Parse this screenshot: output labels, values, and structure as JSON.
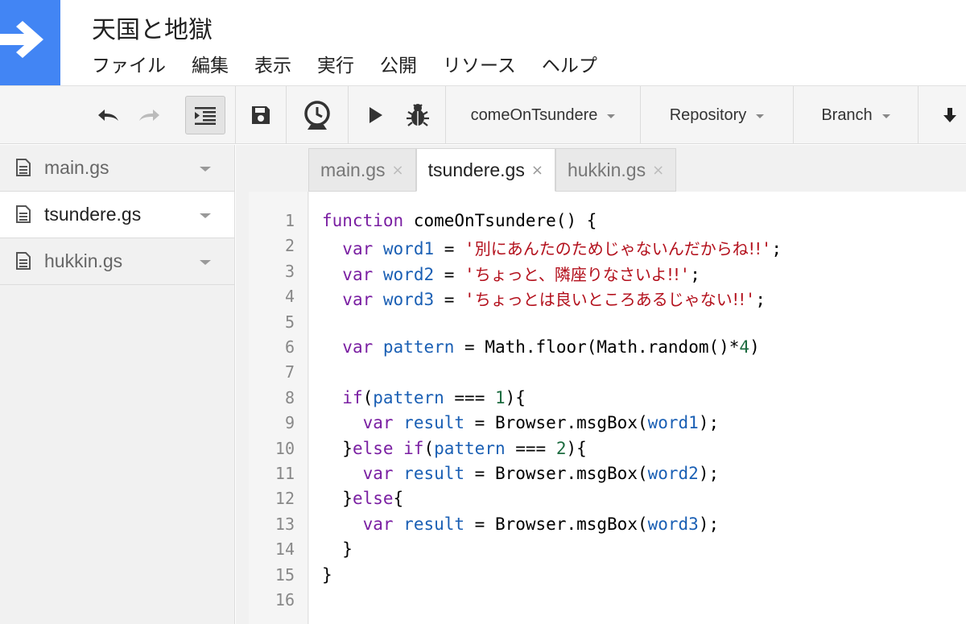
{
  "app": {
    "title": "天国と地獄",
    "menu": [
      "ファイル",
      "編集",
      "表示",
      "実行",
      "公開",
      "リソース",
      "ヘルプ"
    ]
  },
  "toolbar": {
    "function_select": "comeOnTsundere",
    "repository": "Repository",
    "branch": "Branch"
  },
  "sidebar": {
    "files": [
      {
        "name": "main.gs",
        "active": false
      },
      {
        "name": "tsundere.gs",
        "active": true
      },
      {
        "name": "hukkin.gs",
        "active": false
      }
    ]
  },
  "tabs": [
    {
      "name": "main.gs",
      "close": "×",
      "active": false
    },
    {
      "name": "tsundere.gs",
      "close": "×",
      "active": true
    },
    {
      "name": "hukkin.gs",
      "close": "×",
      "active": false
    }
  ],
  "code": {
    "line_numbers": [
      "1",
      "2",
      "3",
      "4",
      "5",
      "6",
      "7",
      "8",
      "9",
      "10",
      "11",
      "12",
      "13",
      "14",
      "15",
      "16"
    ],
    "lines": [
      [
        [
          "k",
          "function"
        ],
        [
          "p",
          " comeOnTsundere() {"
        ]
      ],
      [
        [
          "p",
          "  "
        ],
        [
          "k",
          "var"
        ],
        [
          "p",
          " "
        ],
        [
          "v",
          "word1"
        ],
        [
          "p",
          " = "
        ],
        [
          "s",
          "'"
        ],
        [
          "j",
          "別にあんたのためじゃないんだからね!!"
        ],
        [
          "s",
          "'"
        ],
        [
          "p",
          ";"
        ]
      ],
      [
        [
          "p",
          "  "
        ],
        [
          "k",
          "var"
        ],
        [
          "p",
          " "
        ],
        [
          "v",
          "word2"
        ],
        [
          "p",
          " = "
        ],
        [
          "s",
          "'"
        ],
        [
          "j",
          "ちょっと、隣座りなさいよ!!"
        ],
        [
          "s",
          "'"
        ],
        [
          "p",
          ";"
        ]
      ],
      [
        [
          "p",
          "  "
        ],
        [
          "k",
          "var"
        ],
        [
          "p",
          " "
        ],
        [
          "v",
          "word3"
        ],
        [
          "p",
          " = "
        ],
        [
          "s",
          "'"
        ],
        [
          "j",
          "ちょっとは良いところあるじゃない!!"
        ],
        [
          "s",
          "'"
        ],
        [
          "p",
          ";"
        ]
      ],
      [
        [
          "p",
          ""
        ]
      ],
      [
        [
          "p",
          "  "
        ],
        [
          "k",
          "var"
        ],
        [
          "p",
          " "
        ],
        [
          "v",
          "pattern"
        ],
        [
          "p",
          " = Math.floor(Math.random()*"
        ],
        [
          "n",
          "4"
        ],
        [
          "p",
          ")"
        ]
      ],
      [
        [
          "p",
          ""
        ]
      ],
      [
        [
          "p",
          "  "
        ],
        [
          "k",
          "if"
        ],
        [
          "p",
          "("
        ],
        [
          "v",
          "pattern"
        ],
        [
          "p",
          " === "
        ],
        [
          "n",
          "1"
        ],
        [
          "p",
          "){"
        ]
      ],
      [
        [
          "p",
          "    "
        ],
        [
          "k",
          "var"
        ],
        [
          "p",
          " "
        ],
        [
          "v",
          "result"
        ],
        [
          "p",
          " = Browser.msgBox("
        ],
        [
          "v",
          "word1"
        ],
        [
          "p",
          ");"
        ]
      ],
      [
        [
          "p",
          "  }"
        ],
        [
          "k",
          "else if"
        ],
        [
          "p",
          "("
        ],
        [
          "v",
          "pattern"
        ],
        [
          "p",
          " === "
        ],
        [
          "n",
          "2"
        ],
        [
          "p",
          "){"
        ]
      ],
      [
        [
          "p",
          "    "
        ],
        [
          "k",
          "var"
        ],
        [
          "p",
          " "
        ],
        [
          "v",
          "result"
        ],
        [
          "p",
          " = Browser.msgBox("
        ],
        [
          "v",
          "word2"
        ],
        [
          "p",
          ");"
        ]
      ],
      [
        [
          "p",
          "  }"
        ],
        [
          "k",
          "else"
        ],
        [
          "p",
          "{"
        ]
      ],
      [
        [
          "p",
          "    "
        ],
        [
          "k",
          "var"
        ],
        [
          "p",
          " "
        ],
        [
          "v",
          "result"
        ],
        [
          "p",
          " = Browser.msgBox("
        ],
        [
          "v",
          "word3"
        ],
        [
          "p",
          ");"
        ]
      ],
      [
        [
          "p",
          "  }"
        ]
      ],
      [
        [
          "p",
          "}"
        ]
      ],
      [
        [
          "p",
          ""
        ]
      ]
    ]
  }
}
